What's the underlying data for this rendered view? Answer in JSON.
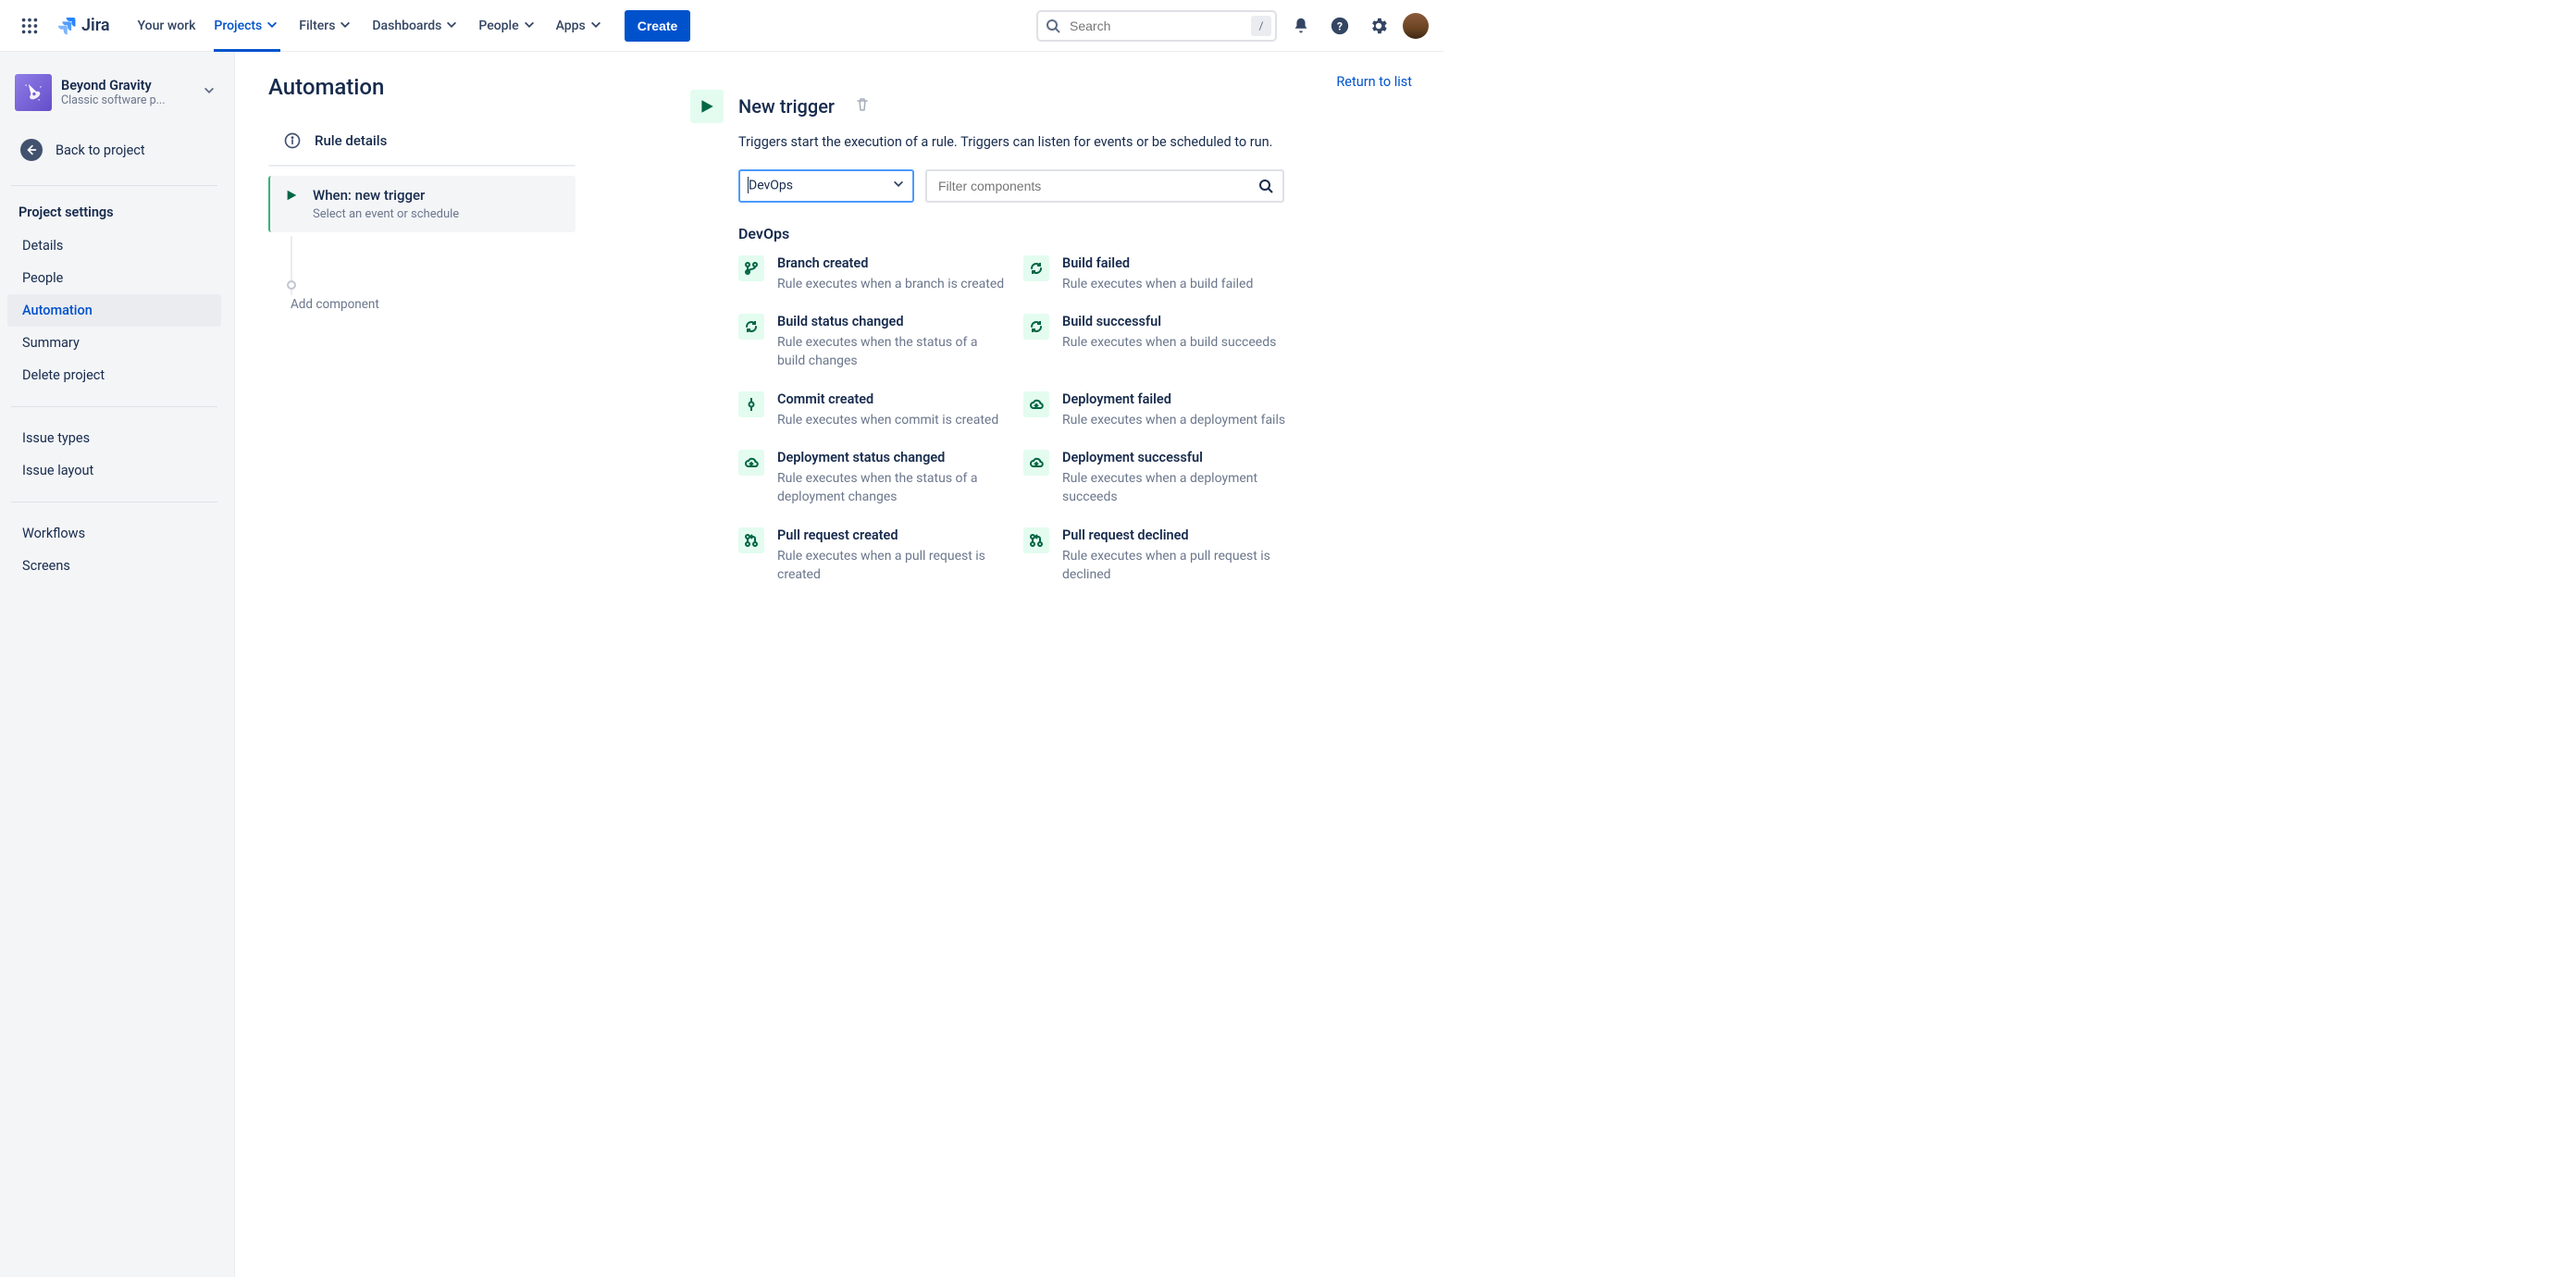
{
  "nav": {
    "product": "Jira",
    "your_work": "Your work",
    "projects": "Projects",
    "filters": "Filters",
    "dashboards": "Dashboards",
    "people": "People",
    "apps": "Apps",
    "create": "Create",
    "search_placeholder": "Search",
    "slash_hint": "/"
  },
  "sidebar": {
    "project_name": "Beyond Gravity",
    "project_type": "Classic software p...",
    "back": "Back to project",
    "heading": "Project settings",
    "items": {
      "details": "Details",
      "people": "People",
      "automation": "Automation",
      "summary": "Summary",
      "delete": "Delete project"
    },
    "issue_types": "Issue types",
    "issue_layout": "Issue layout",
    "workflows": "Workflows",
    "screens": "Screens"
  },
  "page": {
    "title": "Automation",
    "return_link": "Return to list",
    "rule_details": "Rule details",
    "step_title": "When: new trigger",
    "step_sub": "Select an event or schedule",
    "add_component": "Add component"
  },
  "trigger": {
    "title": "New trigger",
    "desc": "Triggers start the execution of a rule. Triggers can listen for events or be scheduled to run.",
    "category_selected": "DevOps",
    "filter_placeholder": "Filter components",
    "section": "DevOps",
    "items": [
      {
        "icon": "branch",
        "name": "Branch created",
        "desc": "Rule executes when a branch is created"
      },
      {
        "icon": "cycle",
        "name": "Build failed",
        "desc": "Rule executes when a build failed"
      },
      {
        "icon": "cycle",
        "name": "Build status changed",
        "desc": "Rule executes when the status of a build changes"
      },
      {
        "icon": "cycle",
        "name": "Build successful",
        "desc": "Rule executes when a build succeeds"
      },
      {
        "icon": "commit",
        "name": "Commit created",
        "desc": "Rule executes when commit is created"
      },
      {
        "icon": "cloud",
        "name": "Deployment failed",
        "desc": "Rule executes when a deployment fails"
      },
      {
        "icon": "cloud",
        "name": "Deployment status changed",
        "desc": "Rule executes when the status of a deployment changes"
      },
      {
        "icon": "cloud",
        "name": "Deployment successful",
        "desc": "Rule executes when a deployment succeeds"
      },
      {
        "icon": "pr",
        "name": "Pull request created",
        "desc": "Rule executes when a pull request is created"
      },
      {
        "icon": "pr",
        "name": "Pull request declined",
        "desc": "Rule executes when a pull request is declined"
      }
    ]
  }
}
